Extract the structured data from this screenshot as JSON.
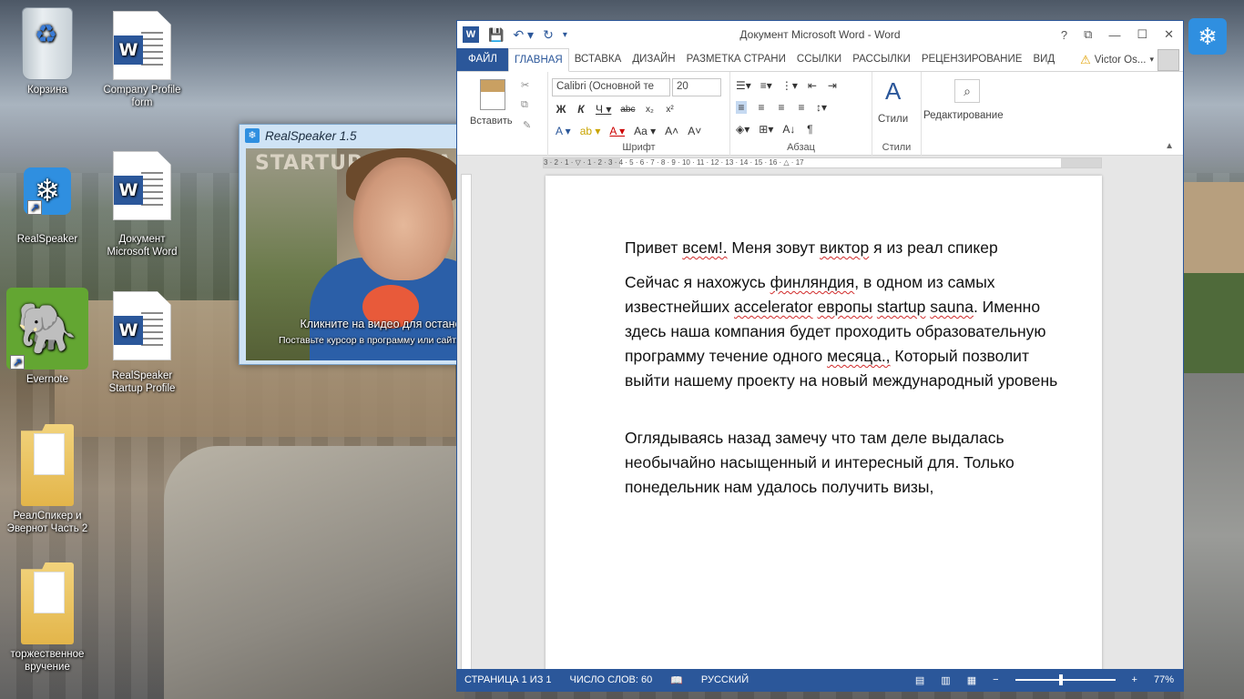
{
  "desktop": {
    "icons": [
      {
        "label": "Корзина"
      },
      {
        "label": "Company Profile form"
      },
      {
        "label": "RealSpeaker"
      },
      {
        "label": "Документ Microsoft Word"
      },
      {
        "label": "Evernote"
      },
      {
        "label": "RealSpeaker Startup Profile"
      },
      {
        "label": "РеалСпикер и Эвернот Часть 2"
      },
      {
        "label": "торжественное вручение"
      }
    ]
  },
  "realspeaker": {
    "title": "RealSpeaker 1.5",
    "video_sign": "STARTUP SAUNA",
    "hint_primary": "Кликните на видео для остановки",
    "hint_secondary": "Поставьте курсор в программу или сайт, диктуйте"
  },
  "word": {
    "title": "Документ Microsoft Word - Word",
    "tabs": [
      "ФАЙЛ",
      "ГЛАВНАЯ",
      "ВСТАВКА",
      "ДИЗАЙН",
      "РАЗМЕТКА СТРАНИ",
      "ССЫЛКИ",
      "РАССЫЛКИ",
      "РЕЦЕНЗИРОВАНИЕ",
      "ВИД"
    ],
    "user": "Victor Os...",
    "ribbon": {
      "paste_label": "Вставить",
      "font_name": "Calibri (Основной те",
      "font_size": "20",
      "group_font": "Шрифт",
      "group_paragraph": "Абзац",
      "group_styles": "Стили",
      "styles_label": "Стили",
      "editing_label": "Редактирование"
    },
    "ruler_text": "3 · 2 · 1 · ▽ · 1 · 2 · 3 · 4 · 5 · 6 · 7 · 8 · 9 · 10 · 11 · 12 · 13 · 14 · 15 · 16 · △ · 17",
    "document": {
      "p1_a": "Привет ",
      "p1_b": "всем!.",
      "p1_c": " Меня зовут ",
      "p1_d": "виктор",
      "p1_e": " я из реал спикер",
      "p2_a": "Сейчас я нахожусь ",
      "p2_b": "финляндия",
      "p2_c": ", в одном из самых известнейших ",
      "p2_d": "accelerator",
      "p2_e": " ",
      "p2_f": "европы",
      "p2_g": " ",
      "p2_h": "startup",
      "p2_i": " ",
      "p2_j": "sauna",
      "p2_k": ". Именно здесь наша компания будет проходить образовательную программу течение одного ",
      "p2_l": "месяца.,",
      "p2_m": " Который позволит выйти нашему проекту на новый международный уровень",
      "p3": "Оглядываясь назад замечу что там деле выдалась необычайно насыщенный и интересный для. Только понедельник нам удалось получить визы,"
    },
    "status": {
      "page": "СТРАНИЦА 1 ИЗ 1",
      "words": "ЧИСЛО СЛОВ: 60",
      "language": "РУССКИЙ",
      "zoom": "77%"
    }
  }
}
